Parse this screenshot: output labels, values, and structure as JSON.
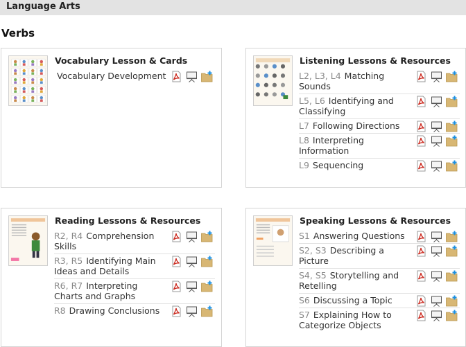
{
  "header": {
    "title": "Language Arts"
  },
  "section": {
    "title": "Verbs"
  },
  "cards": [
    {
      "title": "Vocabulary Lesson & Cards",
      "items": [
        {
          "code": "",
          "label": "Vocabulary Development"
        }
      ]
    },
    {
      "title": "Listening Lessons & Resources",
      "items": [
        {
          "code": "L2, L3, L4",
          "label": "Matching Sounds"
        },
        {
          "code": "L5, L6",
          "label": "Identifying and Classifying"
        },
        {
          "code": "L7",
          "label": "Following Directions"
        },
        {
          "code": "L8",
          "label": "Interpreting Information"
        },
        {
          "code": "L9",
          "label": "Sequencing"
        }
      ]
    },
    {
      "title": "Reading Lessons & Resources",
      "items": [
        {
          "code": "R2, R4",
          "label": "Comprehension Skills"
        },
        {
          "code": "R3, R5",
          "label": "Identifying Main Ideas and Details"
        },
        {
          "code": "R6, R7",
          "label": "Interpreting Charts and Graphs"
        },
        {
          "code": "R8",
          "label": "Drawing Conclusions"
        }
      ]
    },
    {
      "title": "Speaking Lessons & Resources",
      "items": [
        {
          "code": "S1",
          "label": "Answering Questions"
        },
        {
          "code": "S2, S3",
          "label": "Describing a Picture"
        },
        {
          "code": "S4, S5",
          "label": "Storytelling and Retelling"
        },
        {
          "code": "S6",
          "label": "Discussing a Topic"
        },
        {
          "code": "S7",
          "label": "Explaining How to Categorize Objects"
        }
      ]
    }
  ],
  "icons": {
    "pdf": "pdf-icon",
    "presentation": "presentation-icon",
    "folder": "folder-add-icon"
  },
  "colors": {
    "pdf": "#cc2a1f",
    "folder": "#d8b774",
    "folder_plus": "#1b8fe0",
    "header_bg": "#e3e3e3"
  }
}
